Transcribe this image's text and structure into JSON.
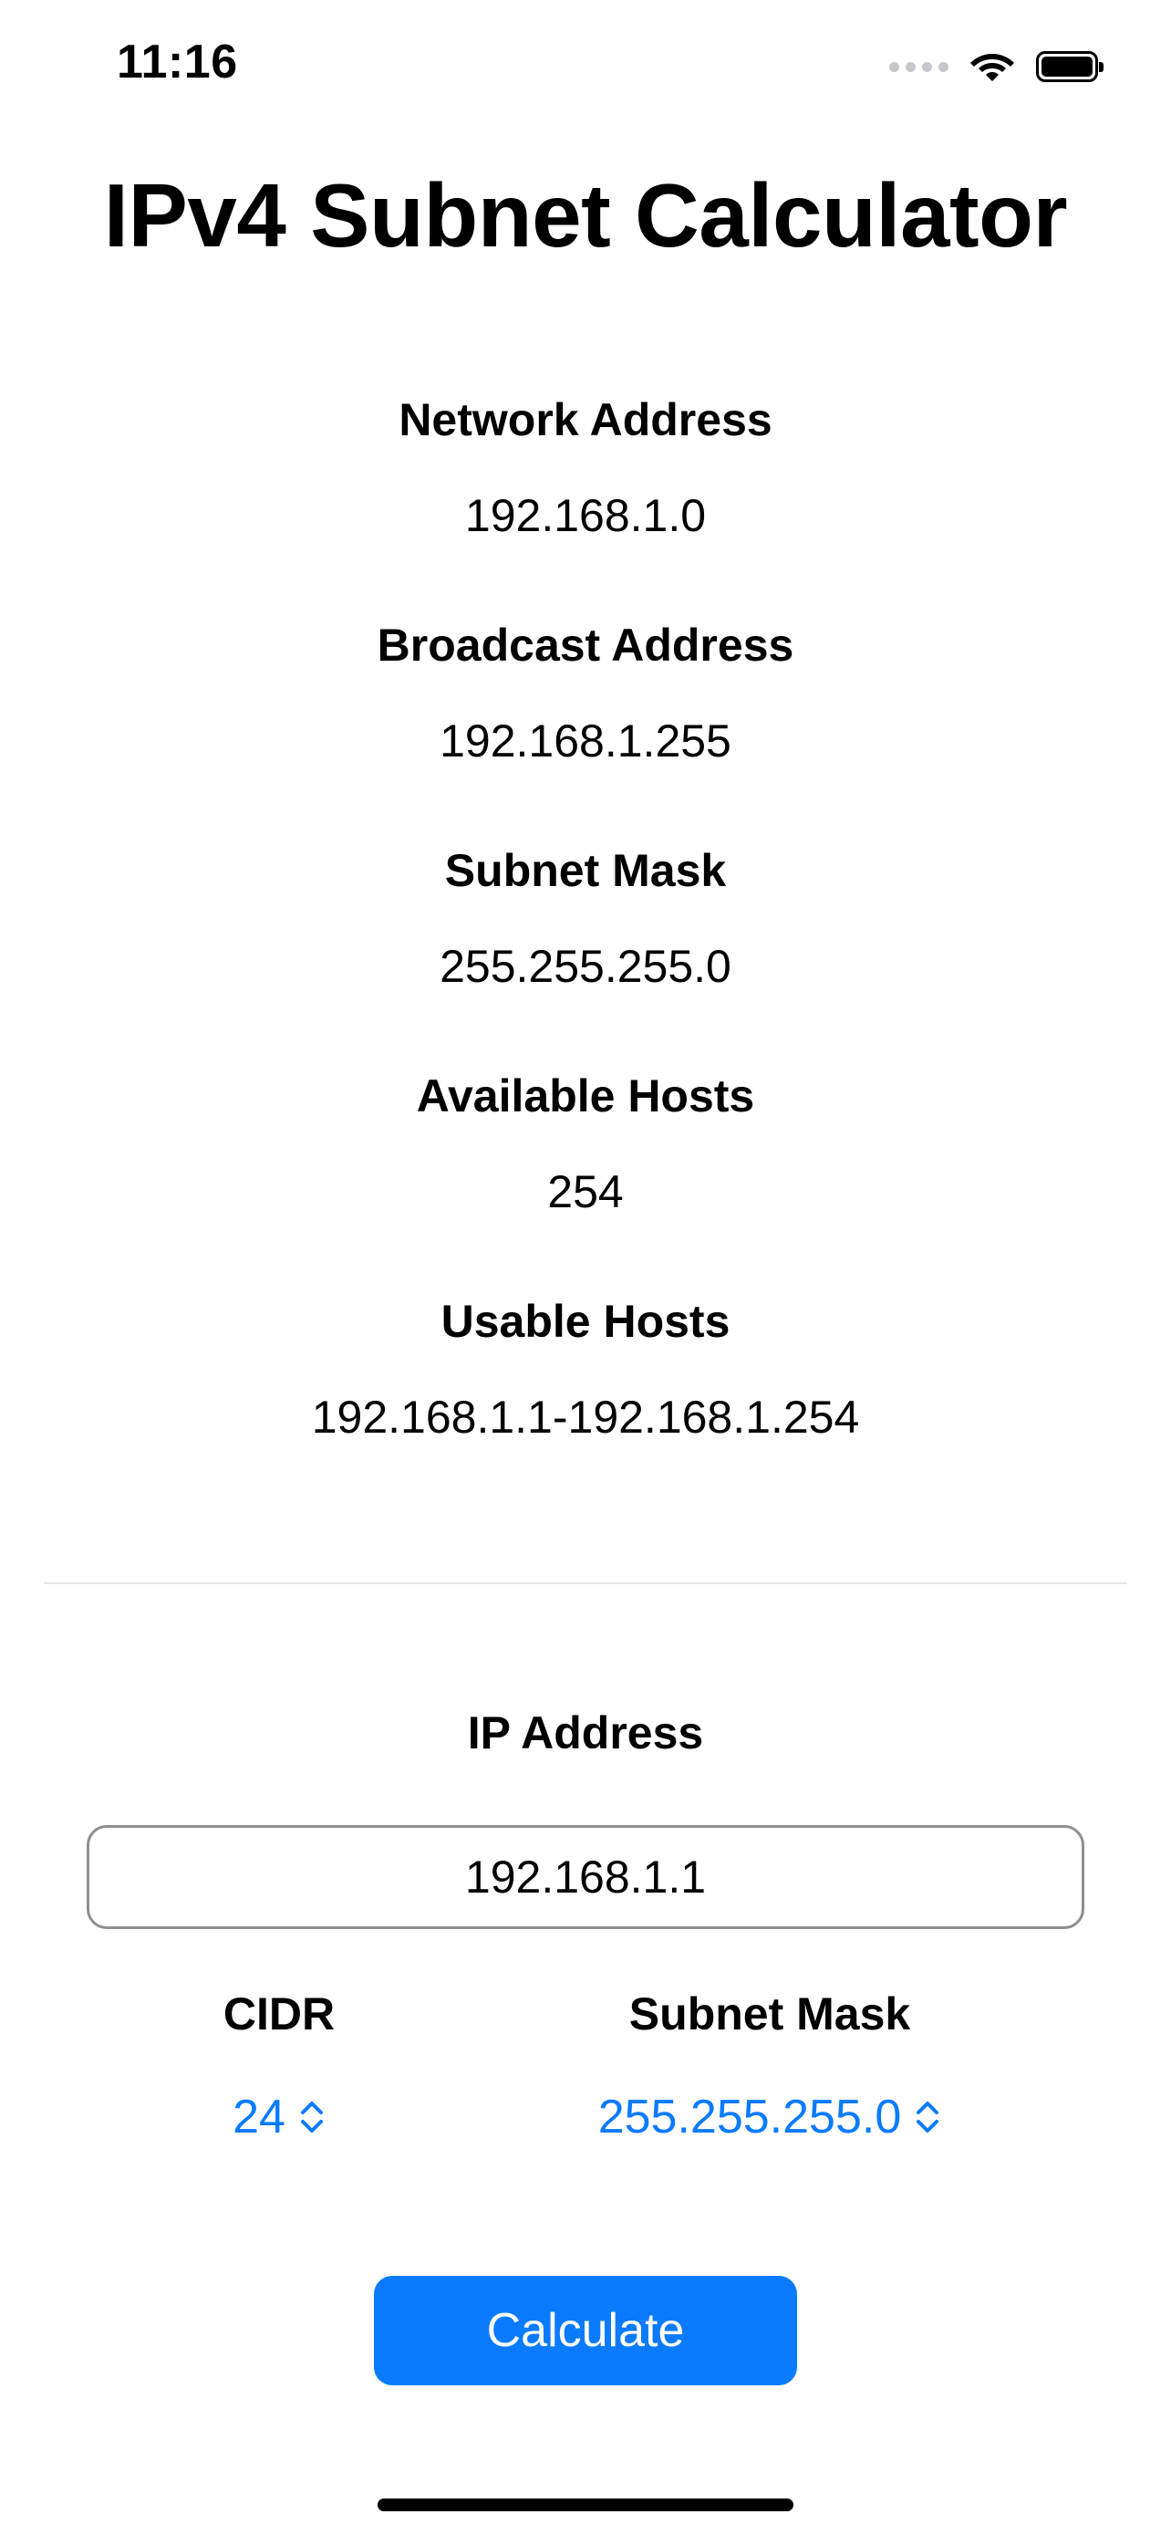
{
  "status_bar": {
    "time": "11:16"
  },
  "title": "IPv4 Subnet Calculator",
  "results": [
    {
      "label": "Network Address",
      "value": "192.168.1.0"
    },
    {
      "label": "Broadcast Address",
      "value": "192.168.1.255"
    },
    {
      "label": "Subnet Mask",
      "value": "255.255.255.0"
    },
    {
      "label": "Available Hosts",
      "value": "254"
    },
    {
      "label": "Usable Hosts",
      "value": "192.168.1.1-192.168.1.254"
    }
  ],
  "input": {
    "ip_label": "IP Address",
    "ip_value": "192.168.1.1",
    "cidr_label": "CIDR",
    "cidr_value": "24",
    "mask_label": "Subnet Mask",
    "mask_value": "255.255.255.0"
  },
  "calculate_label": "Calculate",
  "colors": {
    "accent": "#0a7bff",
    "divider": "#e5e5ea",
    "input_border": "#8e8e93"
  },
  "icons": {
    "wifi": "wifi-icon",
    "battery": "battery-icon",
    "signal": "signal-icon",
    "picker": "chevron-up-down-icon"
  }
}
